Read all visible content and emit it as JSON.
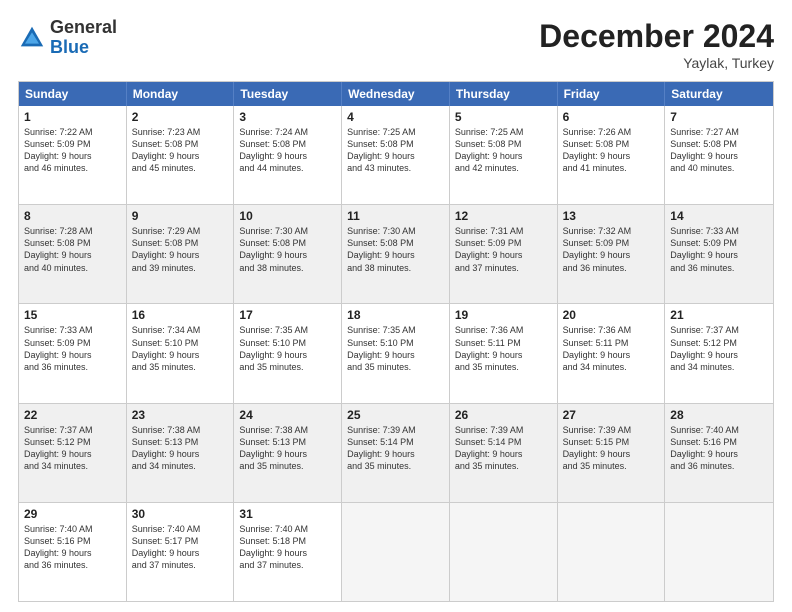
{
  "header": {
    "logo_general": "General",
    "logo_blue": "Blue",
    "month_year": "December 2024",
    "location": "Yaylak, Turkey"
  },
  "weekdays": [
    "Sunday",
    "Monday",
    "Tuesday",
    "Wednesday",
    "Thursday",
    "Friday",
    "Saturday"
  ],
  "rows": [
    [
      {
        "day": "1",
        "text": "Sunrise: 7:22 AM\nSunset: 5:09 PM\nDaylight: 9 hours\nand 46 minutes."
      },
      {
        "day": "2",
        "text": "Sunrise: 7:23 AM\nSunset: 5:08 PM\nDaylight: 9 hours\nand 45 minutes."
      },
      {
        "day": "3",
        "text": "Sunrise: 7:24 AM\nSunset: 5:08 PM\nDaylight: 9 hours\nand 44 minutes."
      },
      {
        "day": "4",
        "text": "Sunrise: 7:25 AM\nSunset: 5:08 PM\nDaylight: 9 hours\nand 43 minutes."
      },
      {
        "day": "5",
        "text": "Sunrise: 7:25 AM\nSunset: 5:08 PM\nDaylight: 9 hours\nand 42 minutes."
      },
      {
        "day": "6",
        "text": "Sunrise: 7:26 AM\nSunset: 5:08 PM\nDaylight: 9 hours\nand 41 minutes."
      },
      {
        "day": "7",
        "text": "Sunrise: 7:27 AM\nSunset: 5:08 PM\nDaylight: 9 hours\nand 40 minutes."
      }
    ],
    [
      {
        "day": "8",
        "text": "Sunrise: 7:28 AM\nSunset: 5:08 PM\nDaylight: 9 hours\nand 40 minutes."
      },
      {
        "day": "9",
        "text": "Sunrise: 7:29 AM\nSunset: 5:08 PM\nDaylight: 9 hours\nand 39 minutes."
      },
      {
        "day": "10",
        "text": "Sunrise: 7:30 AM\nSunset: 5:08 PM\nDaylight: 9 hours\nand 38 minutes."
      },
      {
        "day": "11",
        "text": "Sunrise: 7:30 AM\nSunset: 5:08 PM\nDaylight: 9 hours\nand 38 minutes."
      },
      {
        "day": "12",
        "text": "Sunrise: 7:31 AM\nSunset: 5:09 PM\nDaylight: 9 hours\nand 37 minutes."
      },
      {
        "day": "13",
        "text": "Sunrise: 7:32 AM\nSunset: 5:09 PM\nDaylight: 9 hours\nand 36 minutes."
      },
      {
        "day": "14",
        "text": "Sunrise: 7:33 AM\nSunset: 5:09 PM\nDaylight: 9 hours\nand 36 minutes."
      }
    ],
    [
      {
        "day": "15",
        "text": "Sunrise: 7:33 AM\nSunset: 5:09 PM\nDaylight: 9 hours\nand 36 minutes."
      },
      {
        "day": "16",
        "text": "Sunrise: 7:34 AM\nSunset: 5:10 PM\nDaylight: 9 hours\nand 35 minutes."
      },
      {
        "day": "17",
        "text": "Sunrise: 7:35 AM\nSunset: 5:10 PM\nDaylight: 9 hours\nand 35 minutes."
      },
      {
        "day": "18",
        "text": "Sunrise: 7:35 AM\nSunset: 5:10 PM\nDaylight: 9 hours\nand 35 minutes."
      },
      {
        "day": "19",
        "text": "Sunrise: 7:36 AM\nSunset: 5:11 PM\nDaylight: 9 hours\nand 35 minutes."
      },
      {
        "day": "20",
        "text": "Sunrise: 7:36 AM\nSunset: 5:11 PM\nDaylight: 9 hours\nand 34 minutes."
      },
      {
        "day": "21",
        "text": "Sunrise: 7:37 AM\nSunset: 5:12 PM\nDaylight: 9 hours\nand 34 minutes."
      }
    ],
    [
      {
        "day": "22",
        "text": "Sunrise: 7:37 AM\nSunset: 5:12 PM\nDaylight: 9 hours\nand 34 minutes."
      },
      {
        "day": "23",
        "text": "Sunrise: 7:38 AM\nSunset: 5:13 PM\nDaylight: 9 hours\nand 34 minutes."
      },
      {
        "day": "24",
        "text": "Sunrise: 7:38 AM\nSunset: 5:13 PM\nDaylight: 9 hours\nand 35 minutes."
      },
      {
        "day": "25",
        "text": "Sunrise: 7:39 AM\nSunset: 5:14 PM\nDaylight: 9 hours\nand 35 minutes."
      },
      {
        "day": "26",
        "text": "Sunrise: 7:39 AM\nSunset: 5:14 PM\nDaylight: 9 hours\nand 35 minutes."
      },
      {
        "day": "27",
        "text": "Sunrise: 7:39 AM\nSunset: 5:15 PM\nDaylight: 9 hours\nand 35 minutes."
      },
      {
        "day": "28",
        "text": "Sunrise: 7:40 AM\nSunset: 5:16 PM\nDaylight: 9 hours\nand 36 minutes."
      }
    ],
    [
      {
        "day": "29",
        "text": "Sunrise: 7:40 AM\nSunset: 5:16 PM\nDaylight: 9 hours\nand 36 minutes."
      },
      {
        "day": "30",
        "text": "Sunrise: 7:40 AM\nSunset: 5:17 PM\nDaylight: 9 hours\nand 37 minutes."
      },
      {
        "day": "31",
        "text": "Sunrise: 7:40 AM\nSunset: 5:18 PM\nDaylight: 9 hours\nand 37 minutes."
      },
      {
        "day": "",
        "text": ""
      },
      {
        "day": "",
        "text": ""
      },
      {
        "day": "",
        "text": ""
      },
      {
        "day": "",
        "text": ""
      }
    ]
  ]
}
